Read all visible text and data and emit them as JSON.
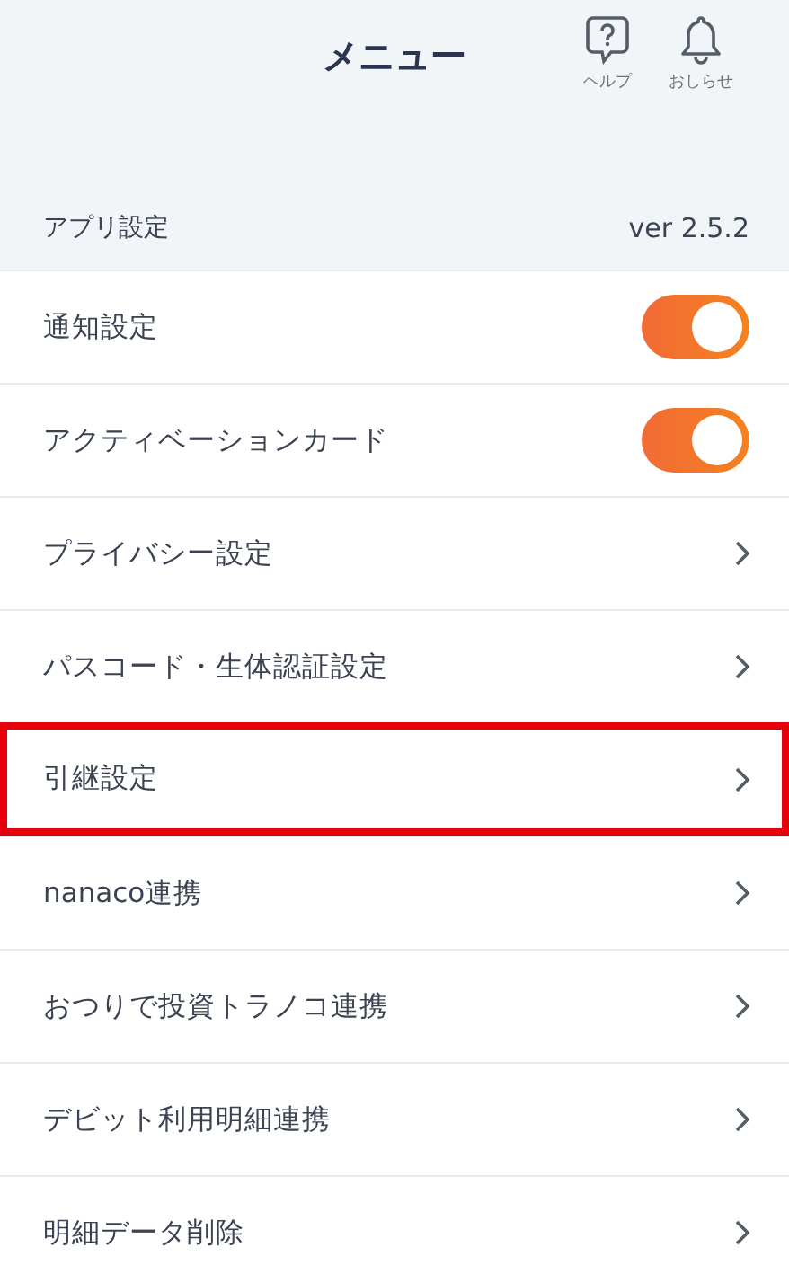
{
  "header": {
    "title": "メニュー",
    "actions": [
      {
        "kind": "help",
        "label": "ヘルプ"
      },
      {
        "kind": "bell",
        "label": "おしらせ"
      }
    ]
  },
  "section": {
    "title": "アプリ設定",
    "version": "ver 2.5.2"
  },
  "items": [
    {
      "kind": "toggle",
      "label": "通知設定",
      "on": true,
      "highlighted": false
    },
    {
      "kind": "toggle",
      "label": "アクティベーションカード",
      "on": true,
      "highlighted": false
    },
    {
      "kind": "link",
      "label": "プライバシー設定",
      "highlighted": false
    },
    {
      "kind": "link",
      "label": "パスコード・生体認証設定",
      "highlighted": false
    },
    {
      "kind": "link",
      "label": "引継設定",
      "highlighted": true
    },
    {
      "kind": "link",
      "label": "nanaco連携",
      "highlighted": false
    },
    {
      "kind": "link",
      "label": "おつりで投資トラノコ連携",
      "highlighted": false
    },
    {
      "kind": "link",
      "label": "デビット利用明細連携",
      "highlighted": false
    },
    {
      "kind": "link",
      "label": "明細データ削除",
      "highlighted": false
    }
  ]
}
